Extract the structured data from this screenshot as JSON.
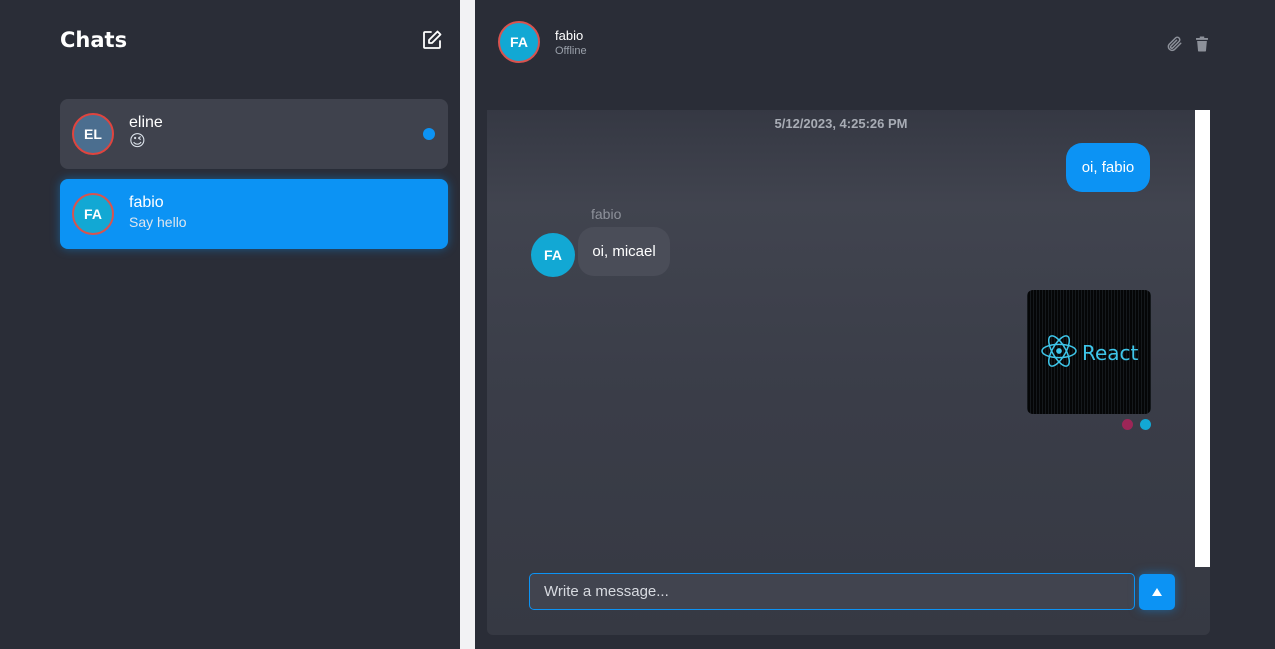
{
  "sidebar": {
    "title": "Chats",
    "new_chat_icon": "edit-icon",
    "contacts": [
      {
        "initials": "EL",
        "name": "eline",
        "preview": "😉",
        "unread": true
      },
      {
        "initials": "FA",
        "name": "fabio",
        "preview": "Say hello",
        "selected": true
      }
    ]
  },
  "header": {
    "initials": "FA",
    "name": "fabio",
    "status": "Offline",
    "icons": [
      "paperclip-icon",
      "trash-icon"
    ]
  },
  "conversation": {
    "timestamp": "5/12/2023, 4:25:26 PM",
    "messages": [
      {
        "from": "me",
        "text": "oi, fabio"
      },
      {
        "from": "fabio",
        "sender_label": "fabio",
        "sender_initials": "FA",
        "text": "oi, micael"
      },
      {
        "from": "me",
        "type": "image",
        "image_text": "React",
        "image_logo": "react-logo-icon"
      }
    ]
  },
  "composer": {
    "placeholder": "Write a message...",
    "value": "",
    "send_icon": "triangle-up-icon"
  },
  "colors": {
    "accent": "#0c93f4",
    "background": "#2a2d37",
    "card": "#3f424d",
    "avatar_teal": "#12a8d4"
  }
}
